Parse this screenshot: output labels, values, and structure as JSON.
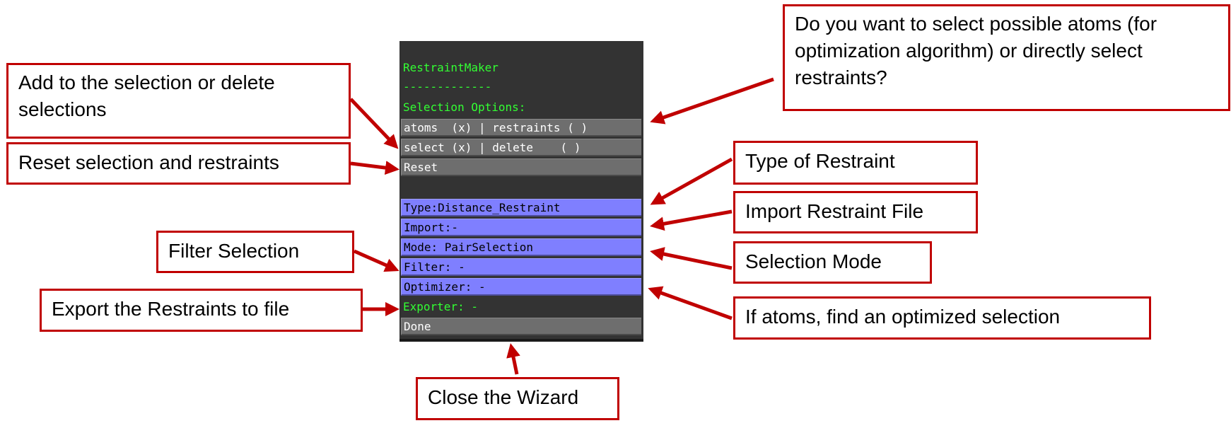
{
  "panel": {
    "title": "RestraintMaker",
    "separator": "-------------",
    "section_label": "Selection Options:",
    "rows": {
      "selection_type": "atoms  (x) | restraints ( )",
      "selection_action": "select (x) | delete    ( )",
      "reset": "Reset",
      "type": "Type:Distance_Restraint",
      "import": "Import:-",
      "mode": "Mode: PairSelection",
      "filter": "Filter: -",
      "optimizer": "Optimizer: -",
      "exporter": "Exporter: -",
      "done": "Done"
    }
  },
  "annotations": {
    "add_delete": "Add to the selection or delete selections",
    "reset": "Reset selection and restraints",
    "atoms_or_restraints": "Do you want to select possible atoms (for optimization algorithm) or directly select restraints?",
    "type": "Type of Restraint",
    "import": "Import Restraint File",
    "filter": "Filter Selection",
    "mode": "Selection Mode",
    "export": "Export the Restraints to file",
    "optimizer": "If atoms, find an optimized selection",
    "done": "Close the Wizard"
  },
  "colors": {
    "arrow": "#c00000",
    "panel_bg": "#333333",
    "green_text": "#33ff33",
    "blue_row": "#7f7fff",
    "gray_row": "#6e6e6e"
  }
}
